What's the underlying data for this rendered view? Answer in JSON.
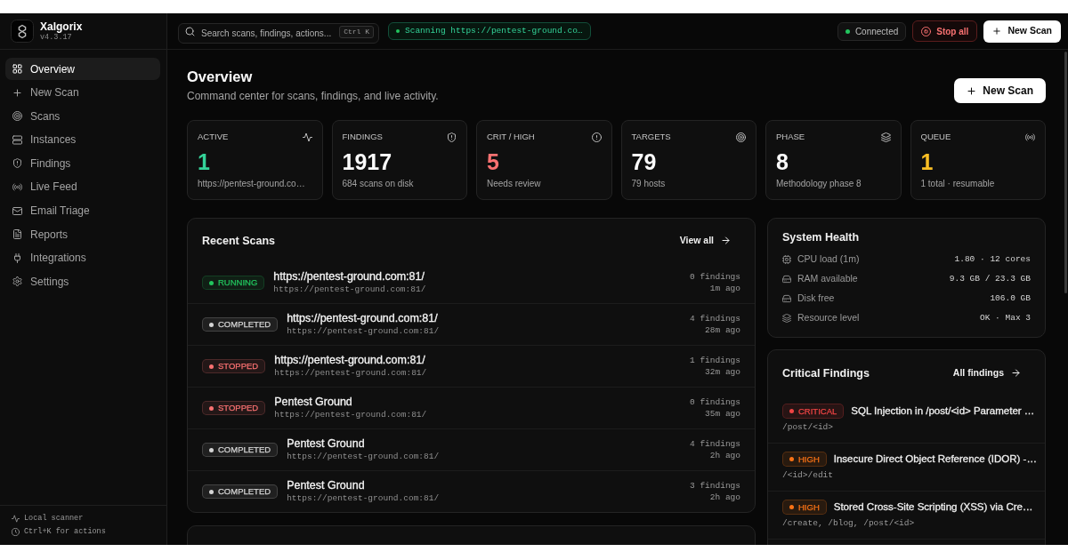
{
  "sidebar": {
    "brand": {
      "name": "Xalgorix",
      "version": "v4.3.17"
    },
    "items": [
      {
        "label": "Overview",
        "selected": true
      },
      {
        "label": "New Scan",
        "selected": false
      },
      {
        "label": "Scans",
        "selected": false
      },
      {
        "label": "Instances",
        "selected": false
      },
      {
        "label": "Findings",
        "selected": false
      },
      {
        "label": "Live Feed",
        "selected": false
      },
      {
        "label": "Email Triage",
        "selected": false
      },
      {
        "label": "Reports",
        "selected": false
      },
      {
        "label": "Integrations",
        "selected": false
      },
      {
        "label": "Settings",
        "selected": false
      }
    ],
    "footer": [
      "Local scanner",
      "Ctrl+K for actions"
    ]
  },
  "top_bar": {
    "search": {
      "placeholder": "Search scans, findings, actions...",
      "shortcut": "Ctrl K"
    },
    "scan_status": "Scanning https://pentest-ground.co…",
    "connection": "Connected",
    "stop_button": "Stop all",
    "new_scan_button": "New Scan"
  },
  "header": {
    "title": "Overview",
    "subtitle": "Command center for scans, findings, and live activity.",
    "new_scan_button": "New Scan"
  },
  "stats": [
    {
      "label": "ACTIVE",
      "value": "1",
      "color": "#34d399",
      "note": "https://pentest-ground.co…"
    },
    {
      "label": "FINDINGS",
      "value": "1917",
      "color": "#fafafa",
      "note": "684 scans on disk"
    },
    {
      "label": "CRIT / HIGH",
      "value": "5",
      "color": "#f87171",
      "note": "Needs review"
    },
    {
      "label": "TARGETS",
      "value": "79",
      "color": "#fafafa",
      "note": "79 hosts"
    },
    {
      "label": "PHASE",
      "value": "8",
      "color": "#fafafa",
      "note": "Methodology phase 8"
    },
    {
      "label": "QUEUE",
      "value": "1",
      "color": "#fbbf24",
      "note": "1 total · resumable"
    }
  ],
  "recent_scans": {
    "title": "Recent Scans",
    "view_all": "View all",
    "rows": [
      {
        "status": {
          "label": "RUNNING",
          "color": "#22c55e"
        },
        "name": "https://pentest-ground.com:81/",
        "url": "https://pentest-ground.com:81/",
        "findings": "0 findings",
        "time": "1m ago"
      },
      {
        "status": {
          "label": "COMPLETED",
          "color": "#d4d4d4"
        },
        "name": "https://pentest-ground.com:81/",
        "url": "https://pentest-ground.com:81/",
        "findings": "4 findings",
        "time": "28m ago"
      },
      {
        "status": {
          "label": "STOPPED",
          "color": "#f87171"
        },
        "name": "https://pentest-ground.com:81/",
        "url": "https://pentest-ground.com:81/",
        "findings": "1 findings",
        "time": "32m ago"
      },
      {
        "status": {
          "label": "STOPPED",
          "color": "#f87171"
        },
        "name": "Pentest Ground",
        "url": "https://pentest-ground.com:81/",
        "findings": "0 findings",
        "time": "35m ago"
      },
      {
        "status": {
          "label": "COMPLETED",
          "color": "#d4d4d4"
        },
        "name": "Pentest Ground",
        "url": "https://pentest-ground.com:81/",
        "findings": "4 findings",
        "time": "2h ago"
      },
      {
        "status": {
          "label": "COMPLETED",
          "color": "#d4d4d4"
        },
        "name": "Pentest Ground",
        "url": "https://pentest-ground.com:81/",
        "findings": "3 findings",
        "time": "2h ago"
      }
    ]
  },
  "system_health": {
    "title": "System Health",
    "rows": [
      {
        "label": "CPU load (1m)",
        "value": "1.80 · 12 cores"
      },
      {
        "label": "RAM available",
        "value": "9.3 GB / 23.3 GB"
      },
      {
        "label": "Disk free",
        "value": "106.0 GB"
      },
      {
        "label": "Resource level",
        "value": "OK · Max 3"
      }
    ]
  },
  "critical_findings": {
    "title": "Critical Findings",
    "link": "All findings",
    "rows": [
      {
        "severity": {
          "label": "CRITICAL",
          "color": "#ef4444"
        },
        "title": "SQL Injection in /post/<id> Parameter …",
        "path": "/post/<id>"
      },
      {
        "severity": {
          "label": "HIGH",
          "color": "#f97316"
        },
        "title": "Insecure Direct Object Reference (IDOR) -…",
        "path": "/<id>/edit"
      },
      {
        "severity": {
          "label": "HIGH",
          "color": "#f97316"
        },
        "title": "Stored Cross-Site Scripting (XSS) via Cre…",
        "path": "/create, /blog, /post/<id>"
      }
    ]
  }
}
